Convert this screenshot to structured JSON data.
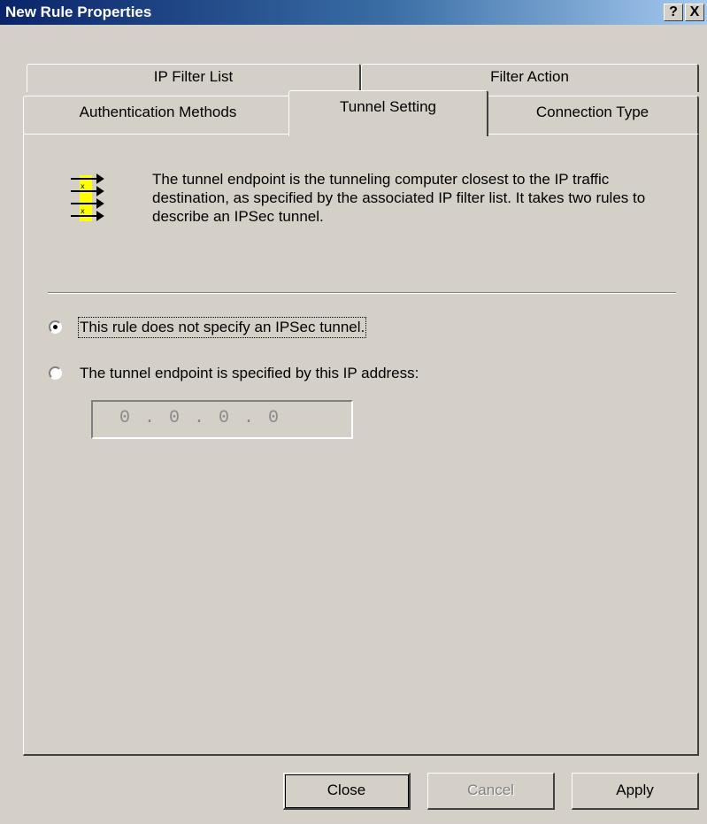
{
  "window": {
    "title": "New Rule Properties",
    "help_label": "?",
    "close_label": "X"
  },
  "tabs": {
    "row_back": [
      {
        "label": "IP Filter List",
        "active": false
      },
      {
        "label": "Filter Action",
        "active": false
      }
    ],
    "row_front": [
      {
        "label": "Authentication Methods",
        "active": false
      },
      {
        "label": "Tunnel Setting",
        "active": true
      },
      {
        "label": "Connection Type",
        "active": false
      }
    ]
  },
  "content": {
    "icon": "tunnel-arrows-icon",
    "description": "The tunnel endpoint is the tunneling computer closest to the IP traffic destination, as specified by the associated IP filter list. It takes two rules to describe an IPSec tunnel.",
    "options": [
      {
        "label": "This rule does not specify an IPSec tunnel.",
        "selected": true
      },
      {
        "label": "The tunnel endpoint is specified by this IP address:",
        "selected": false
      }
    ],
    "ip_address": "0 . 0 . 0 . 0"
  },
  "buttons": {
    "close": "Close",
    "cancel": "Cancel",
    "apply": "Apply"
  }
}
